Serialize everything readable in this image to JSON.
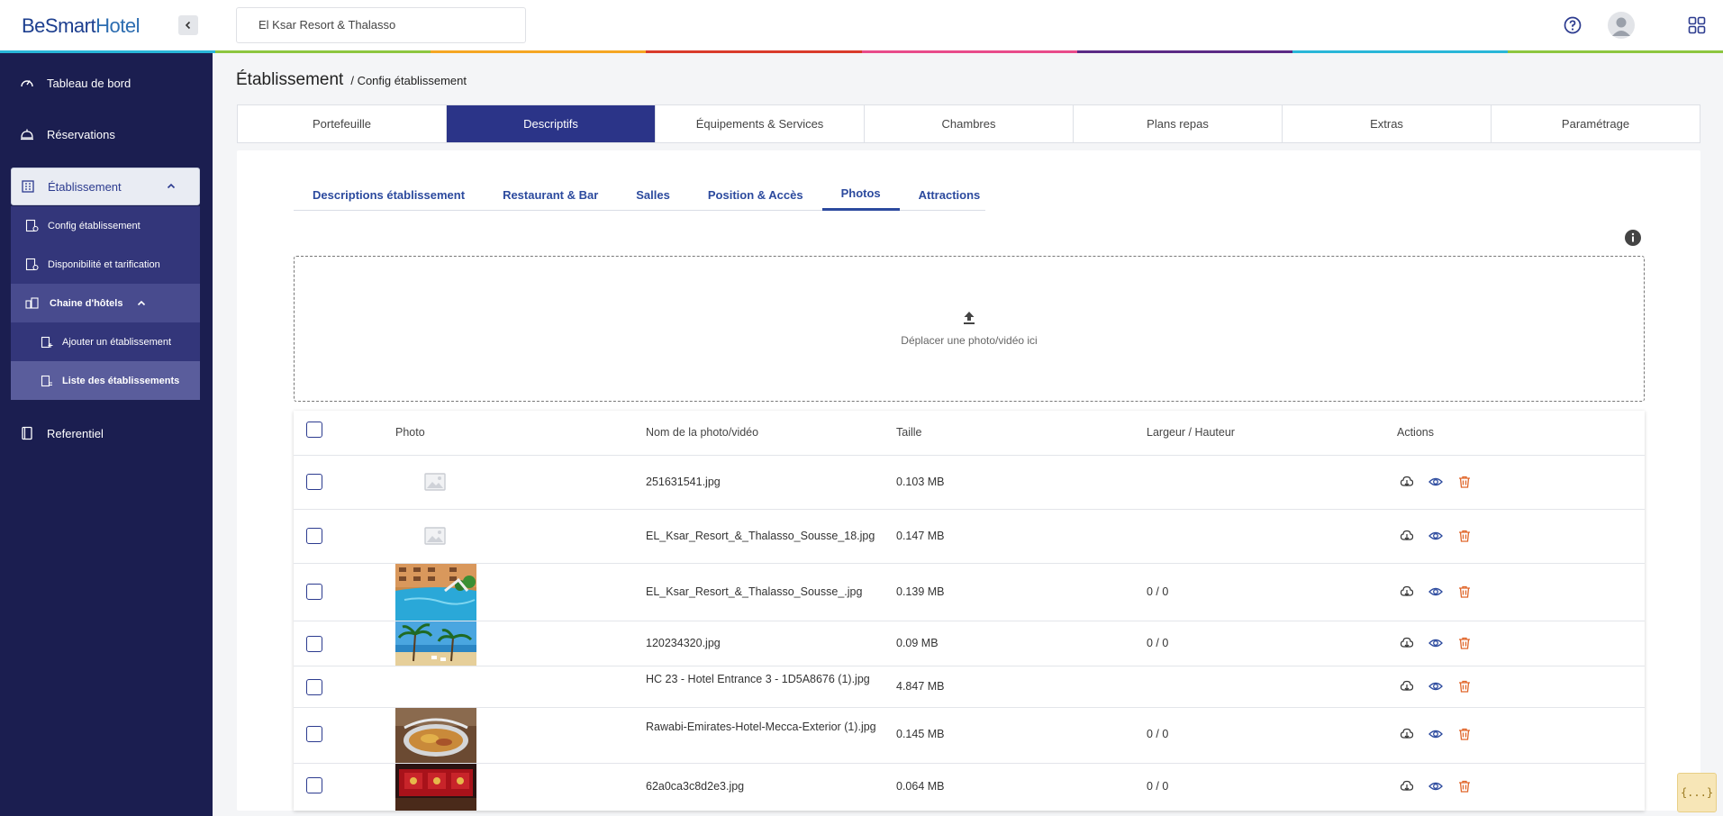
{
  "app": {
    "logo_text": "BeSmart",
    "logo_accent": "Hotel"
  },
  "header": {
    "hotel_selected": "El Ksar Resort & Thalasso"
  },
  "sidebar": {
    "items": [
      {
        "label": "Tableau de bord",
        "icon": "speedometer-icon"
      },
      {
        "label": "Réservations",
        "icon": "bell-icon"
      },
      {
        "label": "Établissement",
        "icon": "building-icon"
      },
      {
        "label": "Referentiel",
        "icon": "book-icon"
      }
    ],
    "sub_items": [
      {
        "label": "Config établissement"
      },
      {
        "label": "Disponibilité et tarification"
      },
      {
        "label": "Chaine d'hôtels"
      },
      {
        "label": "Ajouter un établissement"
      },
      {
        "label": "Liste des établissements"
      }
    ]
  },
  "breadcrumb": {
    "title": "Établissement",
    "sub": "/ Config établissement"
  },
  "main_tabs": [
    "Portefeuille",
    "Descriptifs",
    "Équipements & Services",
    "Chambres",
    "Plans repas",
    "Extras",
    "Paramétrage"
  ],
  "sub_tabs": [
    "Descriptions établissement",
    "Restaurant & Bar",
    "Salles",
    "Position & Accès",
    "Photos",
    "Attractions"
  ],
  "dropzone": {
    "text": "Déplacer une photo/vidéo ici"
  },
  "table": {
    "headers": [
      "Photo",
      "Nom de la photo/vidéo",
      "Taille",
      "Largeur / Hauteur",
      "Actions"
    ],
    "rows": [
      {
        "name": "251631541.jpg",
        "size": "0.103 MB",
        "dims": "",
        "thumb": "placeholder"
      },
      {
        "name": "EL_Ksar_Resort_&_Thalasso_Sousse_18.jpg",
        "size": "0.147 MB",
        "dims": "",
        "thumb": "placeholder"
      },
      {
        "name": "EL_Ksar_Resort_&_Thalasso_Sousse_.jpg",
        "size": "0.139 MB",
        "dims": "0 / 0",
        "thumb": "pool"
      },
      {
        "name": "120234320.jpg",
        "size": "0.09 MB",
        "dims": "0 / 0",
        "thumb": "beach"
      },
      {
        "name": "HC 23 - Hotel Entrance 3 - 1D5A8676 (1).jpg",
        "size": "4.847 MB",
        "dims": "",
        "thumb": "none"
      },
      {
        "name": "Rawabi-Emirates-Hotel-Mecca-Exterior (1).jpg",
        "size": "0.145 MB",
        "dims": "0 / 0",
        "thumb": "food"
      },
      {
        "name": "62a0ca3c8d2e3.jpg",
        "size": "0.064 MB",
        "dims": "0 / 0",
        "thumb": "red"
      }
    ]
  },
  "fab": {
    "label": "{...}"
  },
  "colors": {
    "sidebar_bg": "#1b1e50",
    "accent": "#2b3488",
    "delete": "#e0662a",
    "link": "#2c4a9e"
  }
}
